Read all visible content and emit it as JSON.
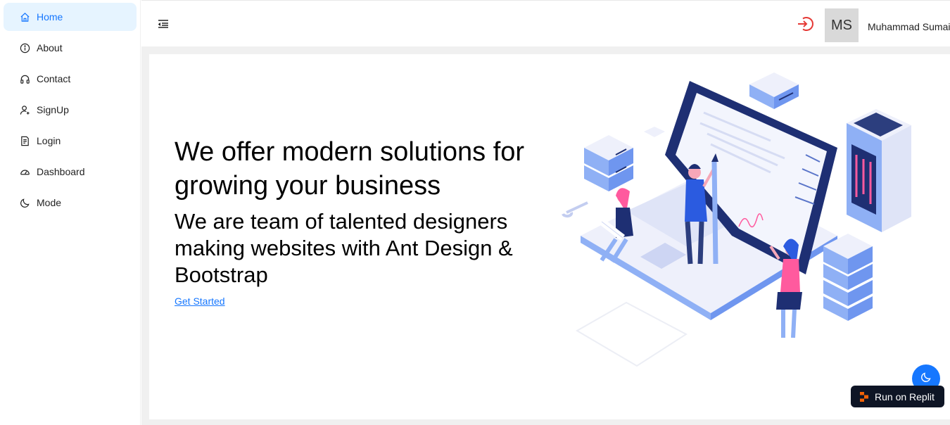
{
  "sidebar": {
    "items": [
      {
        "label": "Home",
        "icon": "home-icon",
        "active": true
      },
      {
        "label": "About",
        "icon": "info-icon",
        "active": false
      },
      {
        "label": "Contact",
        "icon": "headphones-icon",
        "active": false
      },
      {
        "label": "SignUp",
        "icon": "user-add-icon",
        "active": false
      },
      {
        "label": "Login",
        "icon": "file-text-icon",
        "active": false
      },
      {
        "label": "Dashboard",
        "icon": "dashboard-icon",
        "active": false
      },
      {
        "label": "Mode",
        "icon": "moon-icon",
        "active": false
      }
    ]
  },
  "header": {
    "collapse_icon": "menu-fold-icon",
    "logout_icon": "logout-icon",
    "avatar_initials": "MS",
    "user_name": "Muhammad Sumai"
  },
  "hero": {
    "title": "We offer modern solutions for growing your business",
    "subtitle": "We are team of talented designers making websites with Ant Design & Bootstrap",
    "cta_label": "Get Started"
  },
  "floating": {
    "mode_icon": "moon-icon",
    "replit_label": "Run on Replit"
  },
  "colors": {
    "accent": "#1677ff",
    "active_bg": "#e6f4ff",
    "logout": "#e53935",
    "replit_bg": "#0e1525",
    "replit_logo": "#f26207"
  }
}
